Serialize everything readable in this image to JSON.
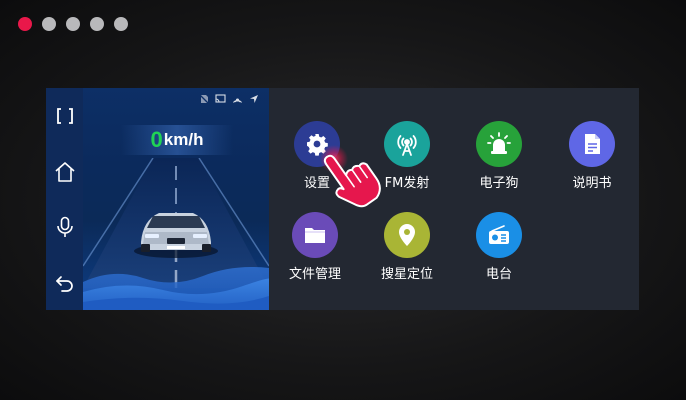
{
  "pager": {
    "count": 5,
    "active_index": 0,
    "colors": {
      "active": "#e9184a",
      "inactive": "#b9b9bb"
    }
  },
  "nav": {
    "items": [
      {
        "name": "fullscreen-icon"
      },
      {
        "name": "home-icon"
      },
      {
        "name": "microphone-icon"
      },
      {
        "name": "back-icon"
      }
    ]
  },
  "status_icons": [
    "sim-off-icon",
    "cast-icon",
    "hotspot-icon",
    "location-arrow-icon"
  ],
  "speed": {
    "value": "0",
    "unit": "km/h",
    "value_color": "#20d455"
  },
  "apps": [
    {
      "label": "设置",
      "icon": "gear-icon",
      "color": "#2c3c94"
    },
    {
      "label": "FM发射",
      "icon": "fm-transmit-icon",
      "color": "#1aa39b"
    },
    {
      "label": "电子狗",
      "icon": "siren-icon",
      "color": "#27a23a"
    },
    {
      "label": "说明书",
      "icon": "document-icon",
      "color": "#5f67e6"
    },
    {
      "label": "文件管理",
      "icon": "folder-icon",
      "color": "#6a4bb8"
    },
    {
      "label": "搜星定位",
      "icon": "map-pin-icon",
      "color": "#a9b535"
    },
    {
      "label": "电台",
      "icon": "radio-icon",
      "color": "#1a8fe6"
    }
  ]
}
